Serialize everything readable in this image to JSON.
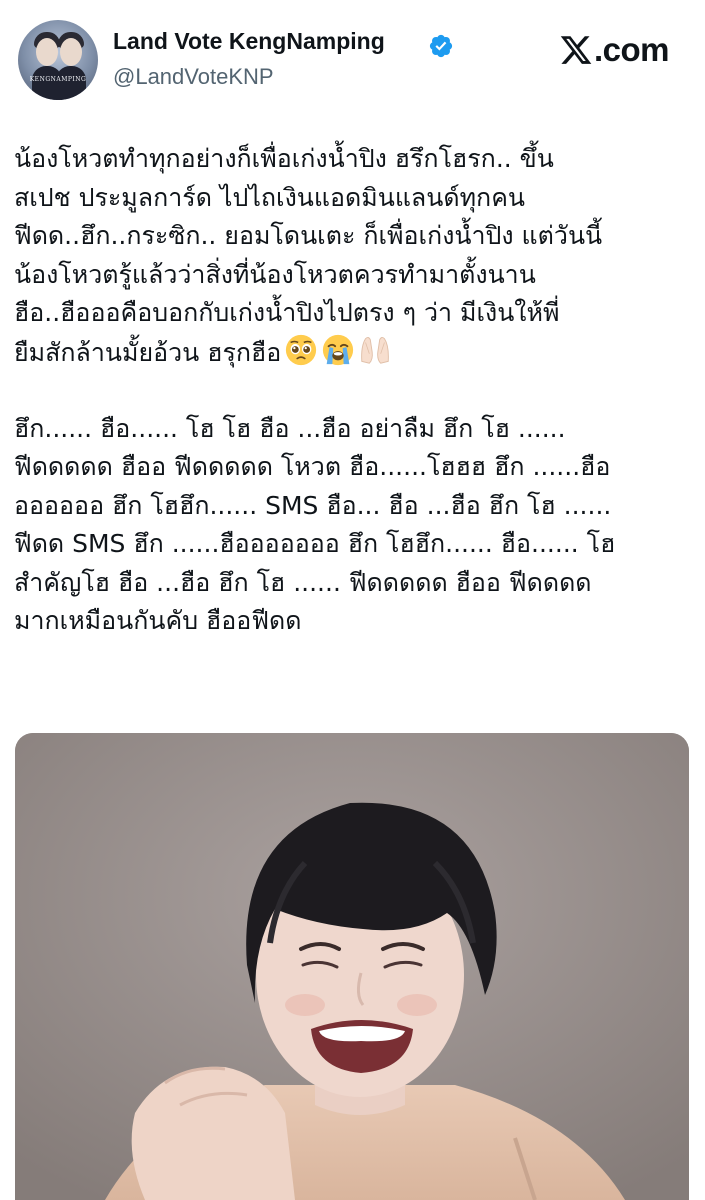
{
  "header": {
    "display_name": "Land Vote KengNamping",
    "handle": "@LandVoteKNP",
    "verified": true,
    "avatar_logo_text": "KENGNAMPING",
    "site_label": ".com"
  },
  "tweet": {
    "paragraph1": [
      "น้องโหวตทำทุกอย่างก็เพื่อเก่งน้ำปิง ฮรึกโฮรก.. ขึ้น",
      "สเปช ประมูลการ์ด ไปไถเงินแอดมินแลนด์ทุกคน",
      "ฟีดด..ฮึก..กระซิก.. ยอมโดนเตะ ก็เพื่อเก่งน้ำปิง แต่วันนี้",
      "น้องโหวตรู้แล้วว่าสิ่งที่น้องโหวตควรทำมาตั้งนาน",
      "ฮือ..ฮือออคือบอกกับเก่งน้ำปิงไปตรง ๆ ว่า มีเงินให้พี่",
      "ยืมสักล้านมั้ยอ้วน ฮรุกฮือ"
    ],
    "emojis": [
      "pleading-face-icon",
      "loudly-crying-face-icon",
      "palms-up-together-icon"
    ],
    "paragraph2": [
      "ฮึก...... ฮือ...... โฮ โฮ ฮือ ...ฮือ อย่าลืม ฮึก โฮ ......",
      "ฟีดดดดด ฮืออ ฟีดดดดด โหวต ฮือ......โฮฮฮ ฮึก ......ฮือ",
      "ออออออ ฮึก โฮฮึก......  SMS ฮือ...  ฮือ ...ฮือ ฮึก โฮ ......",
      "ฟีดด  SMS ฮึก ......ฮือออออออ ฮึก โฮฮึก...... ฮือ...... โฮ",
      "สำคัญโฮ ฮือ ...ฮือ ฮึก โฮ ...... ฟีดดดดด ฮืออ ฟีดดดด",
      "มากเหมือนกันคับ ฮืออฟีดด"
    ]
  },
  "media": {
    "kind": "photo"
  },
  "colors": {
    "text": "#0f1419",
    "secondary_text": "#536471",
    "verified_blue": "#1d9bf0",
    "background": "#ffffff"
  }
}
